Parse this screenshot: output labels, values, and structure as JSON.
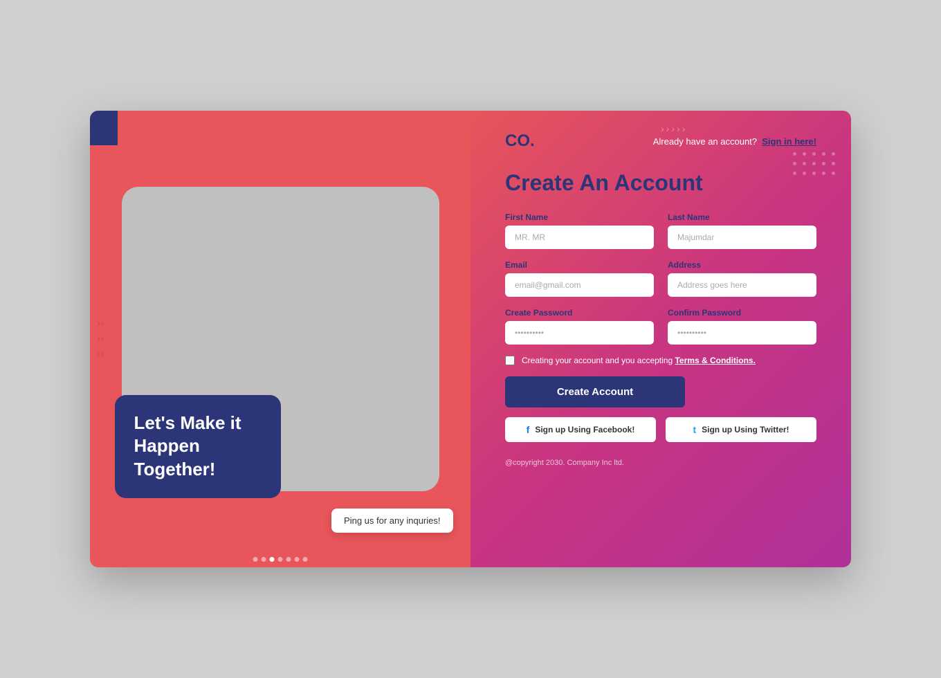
{
  "left": {
    "headline": "Let's Make it Happen Together!",
    "ping_label": "Ping us for any inquries!",
    "dots": [
      false,
      false,
      true,
      false,
      false,
      false,
      false
    ]
  },
  "right": {
    "logo": "CO.",
    "already_text": "Already have an account?",
    "sign_in_label": "Sign in here!",
    "form_title": "Create An Account",
    "fields": {
      "first_name_label": "First Name",
      "first_name_placeholder": "MR. MR",
      "last_name_label": "Last Name",
      "last_name_placeholder": "Majumdar",
      "email_label": "Email",
      "email_placeholder": "email@gmail.com",
      "address_label": "Address",
      "address_placeholder": "Address goes here",
      "password_label": "Create Password",
      "password_placeholder": "••••••••••",
      "confirm_label": "Confirm Password",
      "confirm_placeholder": "••••••••••"
    },
    "checkbox_text": "Creating your account and you accepting",
    "terms_text": "Terms & Conditions.",
    "create_btn": "Create Account",
    "facebook_btn": "Sign up Using Facebook!",
    "twitter_btn": "Sign up Using Twitter!",
    "copyright": "@copyright 2030. Company Inc ltd."
  }
}
